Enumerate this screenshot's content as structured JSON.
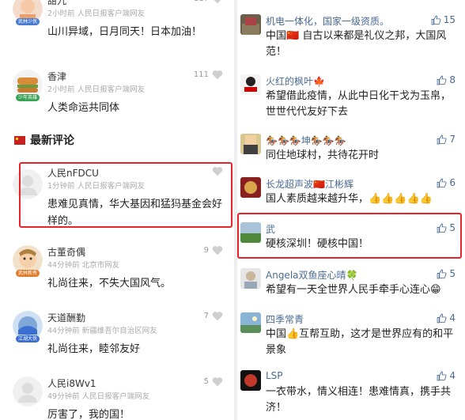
{
  "left": {
    "comments_top": [
      {
        "name": "甜九",
        "meta": "2小时前  人民日报客户端网友",
        "likes": "117",
        "text": "山川异域，日月同天！日本加油！",
        "badge": "武林少侠",
        "badge_color": "#4a7bd0"
      },
      {
        "name": "香津",
        "meta": "2小时前  人民日报客户端网友",
        "likes": "111",
        "text": "人类命运共同体",
        "badge": "少年英雄",
        "badge_color": "#3aa356"
      }
    ],
    "section_title": "最新评论",
    "comments_latest": [
      {
        "name": "人民nFDCU",
        "meta": "1分钟前  人民日报客户端网友",
        "likes": "",
        "text": "患难见真情，华大基因和猛犸基金会好样的。"
      },
      {
        "name": "古董奇偶",
        "meta": "44分钟前  北京市网友",
        "likes": "9",
        "text": "礼尚往来，不失大国风气。",
        "badge": "武林新秀",
        "badge_color": "#e07b2a"
      },
      {
        "name": "天道酬勤",
        "meta": "44分钟前  新疆维吾尔自治区网友",
        "likes": "7",
        "text": "礼尚往来，睦邻友好",
        "badge": "江湖大侠",
        "badge_color": "#3b6fd1"
      },
      {
        "name": "人民i8Wv1",
        "meta": "49分钟前  人民日报客户端网友",
        "likes": "5",
        "text": "厉害了，我的国！"
      }
    ]
  },
  "right": {
    "comments": [
      {
        "name": "机电一体化，国家一级资质。",
        "likes": "15",
        "text": "中国🇨🇳 自古以来都是礼仪之邦，大国风范！"
      },
      {
        "name": "火红的枫叶🍁",
        "likes": "8",
        "text": "希望借此疫情，从此中日化干戈为玉帛，世世代代友好下去"
      },
      {
        "name": "🏇🏇🏇坤🏇🏇🏇",
        "likes": "7",
        "text": "同住地球村，共待花开时"
      },
      {
        "name": "长龙超声波🇨🇳江彬辉",
        "likes": "6",
        "text": "国人素质越来越升华，👍👍👍👍👍"
      },
      {
        "name": "武",
        "likes": "5",
        "text": "硬核深圳！硬核中国！"
      },
      {
        "name": "Angela双鱼座心晴🍀",
        "likes": "5",
        "text": "希望有一天全世界人民手牵手心连心😁"
      },
      {
        "name": "四季常青",
        "likes": "4",
        "text": "中国👍互帮互助，这才是世界应有的和平景象"
      },
      {
        "name": "LSP",
        "likes": "4",
        "text": "一衣带水，情义相连！患难情真，携手共济！"
      }
    ]
  }
}
